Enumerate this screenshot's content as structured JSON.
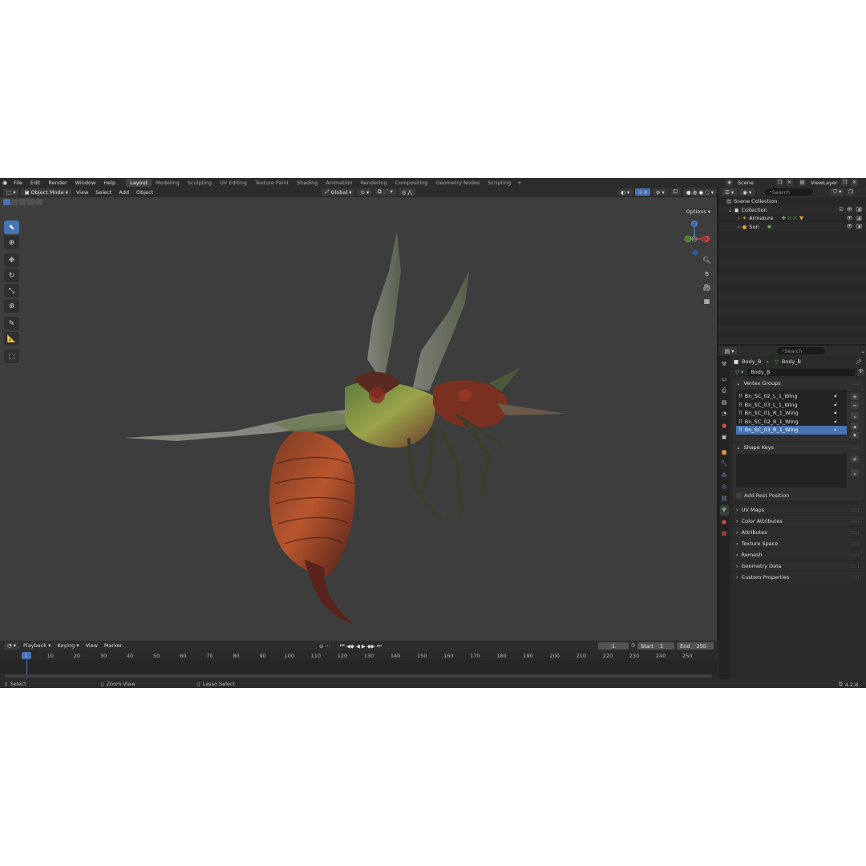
{
  "topbar": {
    "menus": [
      "File",
      "Edit",
      "Render",
      "Window",
      "Help"
    ],
    "workspaces": [
      "Layout",
      "Modeling",
      "Sculpting",
      "UV Editing",
      "Texture Paint",
      "Shading",
      "Animation",
      "Rendering",
      "Compositing",
      "Geometry Nodes",
      "Scripting"
    ],
    "active_workspace": "Layout",
    "scene": "Scene",
    "view_layer": "ViewLayer"
  },
  "viewport": {
    "mode": "Object Mode",
    "menus": [
      "View",
      "Select",
      "Add",
      "Object"
    ],
    "transform_orientation": "Global",
    "options_label": "Options",
    "gizmo": {
      "x": "X",
      "y": "Y",
      "z": "Z"
    }
  },
  "timeline": {
    "menus": [
      "Playback",
      "Keying",
      "View",
      "Marker"
    ],
    "current_frame": "1",
    "start_label": "Start",
    "start": "1",
    "end_label": "End",
    "end": "250",
    "ticks": [
      "10",
      "20",
      "30",
      "40",
      "50",
      "60",
      "70",
      "80",
      "90",
      "100",
      "110",
      "120",
      "130",
      "140",
      "150",
      "160",
      "170",
      "180",
      "190",
      "200",
      "210",
      "220",
      "230",
      "240",
      "250"
    ]
  },
  "status": {
    "select": "Select",
    "zoom": "Zoom View",
    "lasso": "Lasso Select",
    "version": "4.2.8"
  },
  "outliner": {
    "search_placeholder": "Search",
    "scene_collection": "Scene Collection",
    "collection": "Collection",
    "items": [
      {
        "name": "Armature"
      },
      {
        "name": "Sun"
      }
    ]
  },
  "properties": {
    "search_placeholder": "Search",
    "breadcrumb_object": "Body_B",
    "breadcrumb_data": "Body_B",
    "data_name": "Body_B",
    "vertex_groups_title": "Vertex Groups",
    "vertex_groups": [
      "Bn_SC_02_L_1_Wing",
      "Bn_SC_03_L_1_Wing",
      "Bn_SC_01_R_1_Wing",
      "Bn_SC_02_R_1_Wing",
      "Bn_SC_03_R_1_Wing"
    ],
    "selected_vertex_group": 4,
    "shape_keys_title": "Shape Keys",
    "add_rest_position": "Add Rest Position",
    "collapsed_panels": [
      "UV Maps",
      "Color Attributes",
      "Attributes",
      "Texture Space",
      "Remesh",
      "Geometry Data",
      "Custom Properties"
    ]
  },
  "colors": {
    "accent": "#4772b3",
    "viewport_bg": "#3d3d3d",
    "panel_bg": "#2a2a2a",
    "axis_x": "#d9404f",
    "axis_y": "#6ea53d",
    "axis_z": "#3a83d8"
  }
}
